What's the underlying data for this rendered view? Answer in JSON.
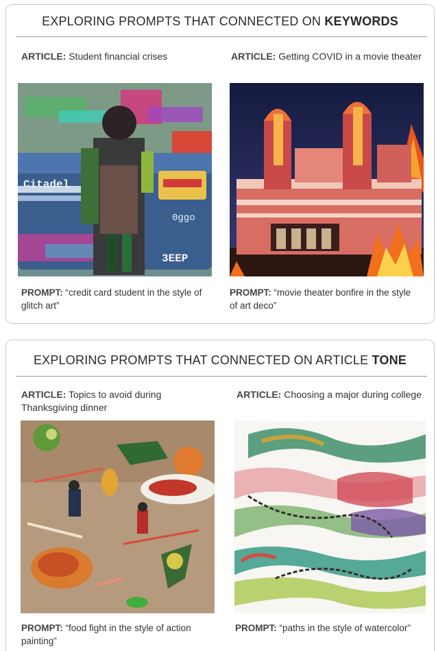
{
  "sections": [
    {
      "title_prefix": "EXPLORING PROMPTS THAT CONNECTED ON ",
      "title_emphasis": "KEYWORDS",
      "items": [
        {
          "article_label": "ARTICLE:",
          "article_text": " Student financial crises",
          "prompt_label": "PROMPT:",
          "prompt_text": " “credit card student in the style of glitch art”",
          "card_text_1": "Citadel",
          "card_text_2": "0ggo",
          "card_text_3": "3EEP"
        },
        {
          "article_label": "ARTICLE:",
          "article_text": " Getting COVID in a movie theater",
          "prompt_label": "PROMPT:",
          "prompt_text": " “movie theater bonfire in the style of art deco”"
        }
      ]
    },
    {
      "title_prefix": "EXPLORING PROMPTS THAT CONNECTED ON ARTICLE ",
      "title_emphasis": "TONE",
      "items": [
        {
          "article_label": "ARTICLE:",
          "article_text": " Topics to avoid during Thanksgiving dinner",
          "prompt_label": "PROMPT:",
          "prompt_text": " “food fight in the style of action painting”"
        },
        {
          "article_label": "ARTICLE:",
          "article_text": " Choosing a major during college",
          "prompt_label": "PROMPT:",
          "prompt_text": " “paths in the style of watercolor”"
        }
      ]
    }
  ]
}
